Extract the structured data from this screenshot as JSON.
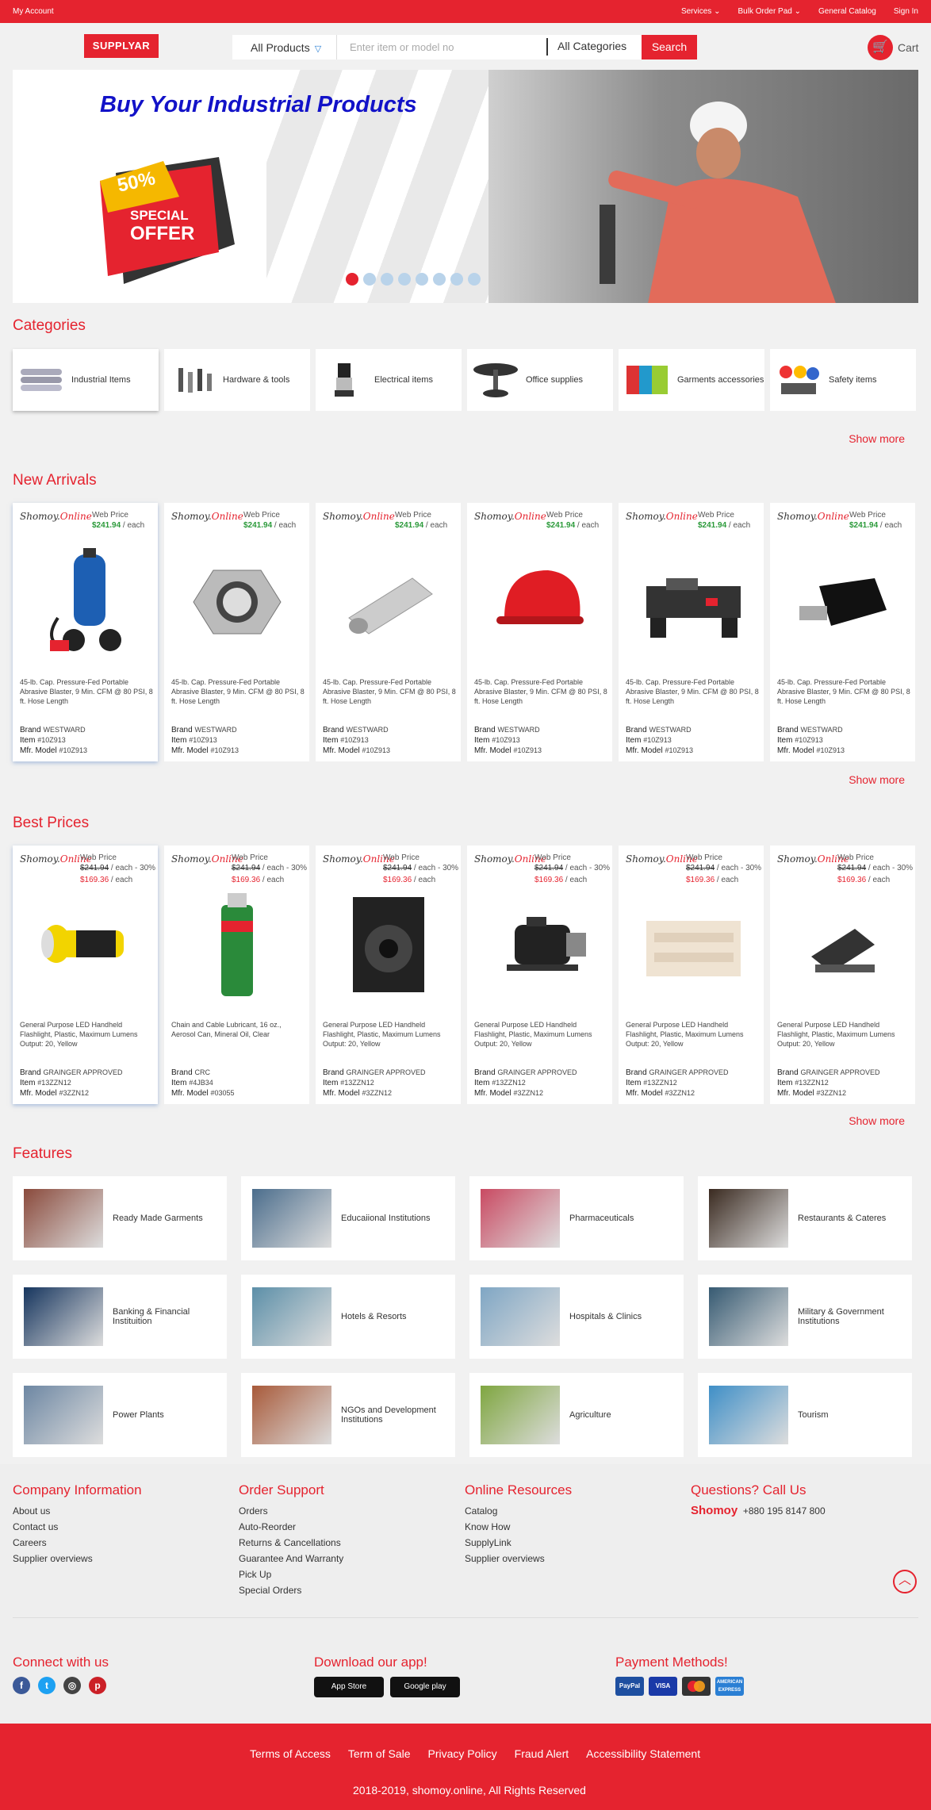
{
  "topbar": {
    "account": "My Account",
    "services": "Services",
    "bulk": "Bulk Order Pad",
    "catalog": "General Catalog",
    "signin": "Sign In"
  },
  "header": {
    "logo": "SUPPLYAR",
    "products": "All Products",
    "search_placeholder": "Enter item or model no",
    "categories": "All Categories",
    "search_btn": "Search",
    "cart": "Cart"
  },
  "banner": {
    "headline": "Buy Your Industrial Products",
    "discount": "50%",
    "special": "SPECIAL",
    "offer": "OFFER",
    "slides": 8,
    "active": 0
  },
  "categories": {
    "title": "Categories",
    "items": [
      {
        "label": "Industrial Items",
        "icon": "pipes-icon"
      },
      {
        "label": "Hardware & tools",
        "icon": "tools-icon"
      },
      {
        "label": "Electrical items",
        "icon": "coffee-grinder-icon"
      },
      {
        "label": "Office supplies",
        "icon": "stamp-rack-icon"
      },
      {
        "label": "Garments accessories",
        "icon": "fabric-icon"
      },
      {
        "label": "Safety items",
        "icon": "safety-gear-icon"
      }
    ],
    "show_more": "Show more"
  },
  "new_arrivals": {
    "title": "New Arrivals",
    "show_more": "Show more",
    "items": [
      {
        "shop": "Shomoy.",
        "shop2": "Online",
        "wp": "Web Price",
        "price": "$241.94",
        "unit": " / each",
        "desc": "45-lb. Cap. Pressure-Fed Portable Abrasive Blaster, 9 Min. CFM @ 80 PSI, 8 ft. Hose Length",
        "brand": "WESTWARD",
        "item": "#10Z913",
        "model": "#10Z913",
        "img": "blaster-icon"
      },
      {
        "shop": "Shomoy.",
        "shop2": "Online",
        "wp": "Web Price",
        "price": "$241.94",
        "unit": " / each",
        "desc": "45-lb. Cap. Pressure-Fed Portable Abrasive Blaster, 9 Min. CFM @ 80 PSI, 8 ft. Hose Length",
        "brand": "WESTWARD",
        "item": "#10Z913",
        "model": "#10Z913",
        "img": "nut-icon"
      },
      {
        "shop": "Shomoy.",
        "shop2": "Online",
        "wp": "Web Price",
        "price": "$241.94",
        "unit": " / each",
        "desc": "45-lb. Cap. Pressure-Fed Portable Abrasive Blaster, 9 Min. CFM @ 80 PSI, 8 ft. Hose Length",
        "brand": "WESTWARD",
        "item": "#10Z913",
        "model": "#10Z913",
        "img": "foil-roll-icon"
      },
      {
        "shop": "Shomoy.",
        "shop2": "Online",
        "wp": "Web Price",
        "price": "$241.94",
        "unit": " / each",
        "desc": "45-lb. Cap. Pressure-Fed Portable Abrasive Blaster, 9 Min. CFM @ 80 PSI, 8 ft. Hose Length",
        "brand": "WESTWARD",
        "item": "#10Z913",
        "model": "#10Z913",
        "img": "helmet-icon"
      },
      {
        "shop": "Shomoy.",
        "shop2": "Online",
        "wp": "Web Price",
        "price": "$241.94",
        "unit": " / each",
        "desc": "45-lb. Cap. Pressure-Fed Portable Abrasive Blaster, 9 Min. CFM @ 80 PSI, 8 ft. Hose Length",
        "brand": "WESTWARD",
        "item": "#10Z913",
        "model": "#10Z913",
        "img": "lathe-icon"
      },
      {
        "shop": "Shomoy.",
        "shop2": "Online",
        "wp": "Web Price",
        "price": "$241.94",
        "unit": " / each",
        "desc": "45-lb. Cap. Pressure-Fed Portable Abrasive Blaster, 9 Min. CFM @ 80 PSI, 8 ft. Hose Length",
        "brand": "WESTWARD",
        "item": "#10Z913",
        "model": "#10Z913",
        "img": "adapter-icon"
      }
    ]
  },
  "best_prices": {
    "title": "Best Prices",
    "show_more": "Show more",
    "items": [
      {
        "shop": "Shomoy.",
        "shop2": "Online",
        "wp": "Web Price",
        "old": "$241.94",
        "oldunit": " / each - 30%",
        "new": "$169.36",
        "unit": " / each",
        "desc": "General Purpose LED Handheld Flashlight, Plastic, Maximum Lumens Output: 20, Yellow",
        "brand": "GRAINGER APPROVED",
        "item": "#13ZZN12",
        "model": "#3ZZN12",
        "img": "flashlight-icon"
      },
      {
        "shop": "Shomoy.",
        "shop2": "Online",
        "wp": "Web Price",
        "old": "$241.94",
        "oldunit": " / each - 30%",
        "new": "$169.36",
        "unit": " / each",
        "desc": "Chain and Cable Lubricant, 16 oz., Aerosol Can, Mineral Oil, Clear",
        "brand": "CRC",
        "item": "#4JB34",
        "model": "#03055",
        "img": "spray-can-icon"
      },
      {
        "shop": "Shomoy.",
        "shop2": "Online",
        "wp": "Web Price",
        "old": "$241.94",
        "oldunit": " / each - 30%",
        "new": "$169.36",
        "unit": " / each",
        "desc": "General Purpose LED Handheld Flashlight, Plastic, Maximum Lumens Output: 20, Yellow",
        "brand": "GRAINGER APPROVED",
        "item": "#13ZZN12",
        "model": "#3ZZN12",
        "img": "speaker-icon"
      },
      {
        "shop": "Shomoy.",
        "shop2": "Online",
        "wp": "Web Price",
        "old": "$241.94",
        "oldunit": " / each - 30%",
        "new": "$169.36",
        "unit": " / each",
        "desc": "General Purpose LED Handheld Flashlight, Plastic, Maximum Lumens Output: 20, Yellow",
        "brand": "GRAINGER APPROVED",
        "item": "#13ZZN12",
        "model": "#3ZZN12",
        "img": "motor-icon"
      },
      {
        "shop": "Shomoy.",
        "shop2": "Online",
        "wp": "Web Price",
        "old": "$241.94",
        "oldunit": " / each - 30%",
        "new": "$169.36",
        "unit": " / each",
        "desc": "General Purpose LED Handheld Flashlight, Plastic, Maximum Lumens Output: 20, Yellow",
        "brand": "GRAINGER APPROVED",
        "item": "#13ZZN12",
        "model": "#3ZZN12",
        "img": "blanket-icon"
      },
      {
        "shop": "Shomoy.",
        "shop2": "Online",
        "wp": "Web Price",
        "old": "$241.94",
        "oldunit": " / each - 30%",
        "new": "$169.36",
        "unit": " / each",
        "desc": "General Purpose LED Handheld Flashlight, Plastic, Maximum Lumens Output: 20, Yellow",
        "brand": "GRAINGER APPROVED",
        "item": "#13ZZN12",
        "model": "#3ZZN12",
        "img": "hole-punch-icon"
      }
    ]
  },
  "features": {
    "title": "Features",
    "items": [
      {
        "label": "Ready Made Garments",
        "color": "#8a4a3c"
      },
      {
        "label": "Educaiional Institutions",
        "color": "#4b6d8c"
      },
      {
        "label": "Pharmaceuticals",
        "color": "#c94a62"
      },
      {
        "label": "Restaurants & Cateres",
        "color": "#3a2a20"
      },
      {
        "label": "Banking & Financial Instituition",
        "color": "#16355e"
      },
      {
        "label": "Hotels & Resorts",
        "color": "#5c8fa8"
      },
      {
        "label": "Hospitals & Clinics",
        "color": "#7fa6c4"
      },
      {
        "label": "Military & Government Institutions",
        "color": "#365a72"
      },
      {
        "label": "Power Plants",
        "color": "#6d87a3"
      },
      {
        "label": "NGOs and Development Institutions",
        "color": "#a85a3a"
      },
      {
        "label": "Agriculture",
        "color": "#7fa640"
      },
      {
        "label": "Tourism",
        "color": "#3f8fc7"
      }
    ]
  },
  "footer": {
    "company": {
      "title": "Company Information",
      "links": [
        "About us",
        "Contact us",
        "Careers",
        "Supplier overviews"
      ]
    },
    "order": {
      "title": "Order Support",
      "links": [
        "Orders",
        "Auto-Reorder",
        "Returns & Cancellations",
        "Guarantee And Warranty",
        "Pick Up",
        "Special Orders"
      ]
    },
    "online": {
      "title": "Online Resources",
      "links": [
        "Catalog",
        "Know How",
        "SupplyLink",
        "Supplier overviews"
      ]
    },
    "call": {
      "title": "Questions? Call Us",
      "name": "Shomoy",
      "phone": "+880 195 8147 800"
    },
    "connect": "Connect with us",
    "download": "Download our app!",
    "payment": "Payment Methods!",
    "appstore": "App Store",
    "googleplay": "Google play",
    "paylabels": [
      "PayPal",
      "VISA",
      "",
      "AMERICAN EXPRESS"
    ]
  },
  "bottom": {
    "links": [
      "Terms of Access",
      "Term of Sale",
      "Privacy Policy",
      "Fraud Alert",
      "Accessibility Statement"
    ],
    "copy": "2018-2019, shomoy.online, All Rights Reserved"
  },
  "colors": {
    "brand": "#e5232f",
    "price_green": "#2b9a3a",
    "dot": "#b9d3ea"
  }
}
